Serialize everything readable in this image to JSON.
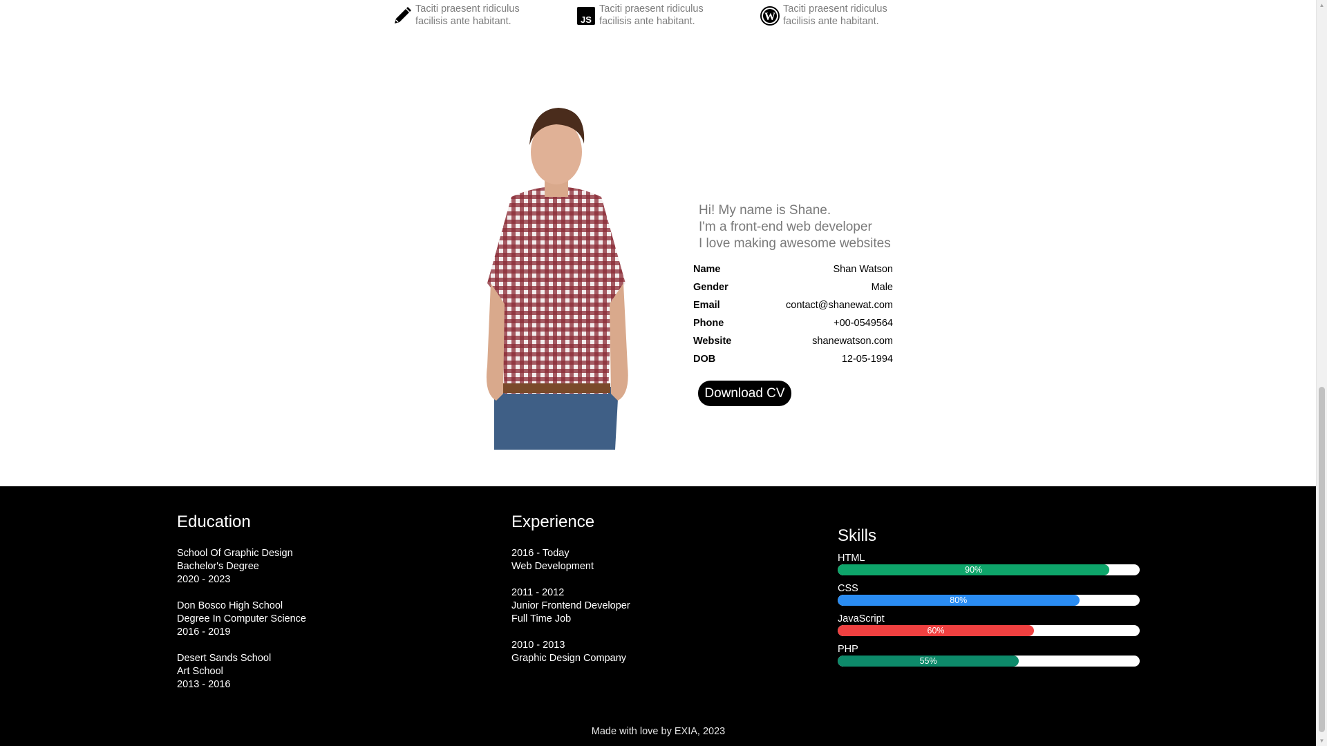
{
  "services": [
    {
      "icon": "pencil-icon",
      "text": "Taciti praesent ridiculus facilisis ante habitant."
    },
    {
      "icon": "javascript-icon",
      "text": "Taciti praesent ridiculus facilisis ante habitant."
    },
    {
      "icon": "wordpress-icon",
      "text": "Taciti praesent ridiculus facilisis ante habitant."
    }
  ],
  "about": {
    "intro": [
      "Hi! My name is Shane.",
      "I'm a front-end web developer",
      "I love making awesome websites"
    ],
    "info": [
      {
        "label": "Name",
        "value": "Shan Watson"
      },
      {
        "label": "Gender",
        "value": "Male"
      },
      {
        "label": "Email",
        "value": "contact@shanewat.com"
      },
      {
        "label": "Phone",
        "value": "+00-0549564"
      },
      {
        "label": "Website",
        "value": "shanewatson.com"
      },
      {
        "label": "DOB",
        "value": "12-05-1994"
      }
    ],
    "cv_button": "Download CV"
  },
  "education": {
    "title": "Education",
    "entries": [
      [
        "School Of Graphic Design",
        "Bachelor's Degree",
        "2020 - 2023"
      ],
      [
        "Don Bosco High School",
        "Degree In Computer Science",
        "2016 - 2019"
      ],
      [
        "Desert Sands School",
        "Art School",
        "2013 - 2016"
      ]
    ]
  },
  "experience": {
    "title": "Experience",
    "entries": [
      [
        "2016 - Today",
        "Web Development"
      ],
      [
        "2011 - 2012",
        "Junior Frontend Developer",
        "Full Time Job"
      ],
      [
        "2010 - 2013",
        "Graphic Design Company"
      ]
    ]
  },
  "skills": {
    "title": "Skills",
    "items": [
      {
        "name": "HTML",
        "percent": 90,
        "label": "90%",
        "color": "#0ea56a"
      },
      {
        "name": "CSS",
        "percent": 80,
        "label": "80%",
        "color": "#2a8cf2"
      },
      {
        "name": "JavaScript",
        "percent": 65,
        "label": "60%",
        "color": "#ef4040"
      },
      {
        "name": "PHP",
        "percent": 60,
        "label": "55%",
        "color": "#0d8a6a"
      }
    ]
  },
  "footer": {
    "credit": "Made with love by EXIA, 2023"
  }
}
